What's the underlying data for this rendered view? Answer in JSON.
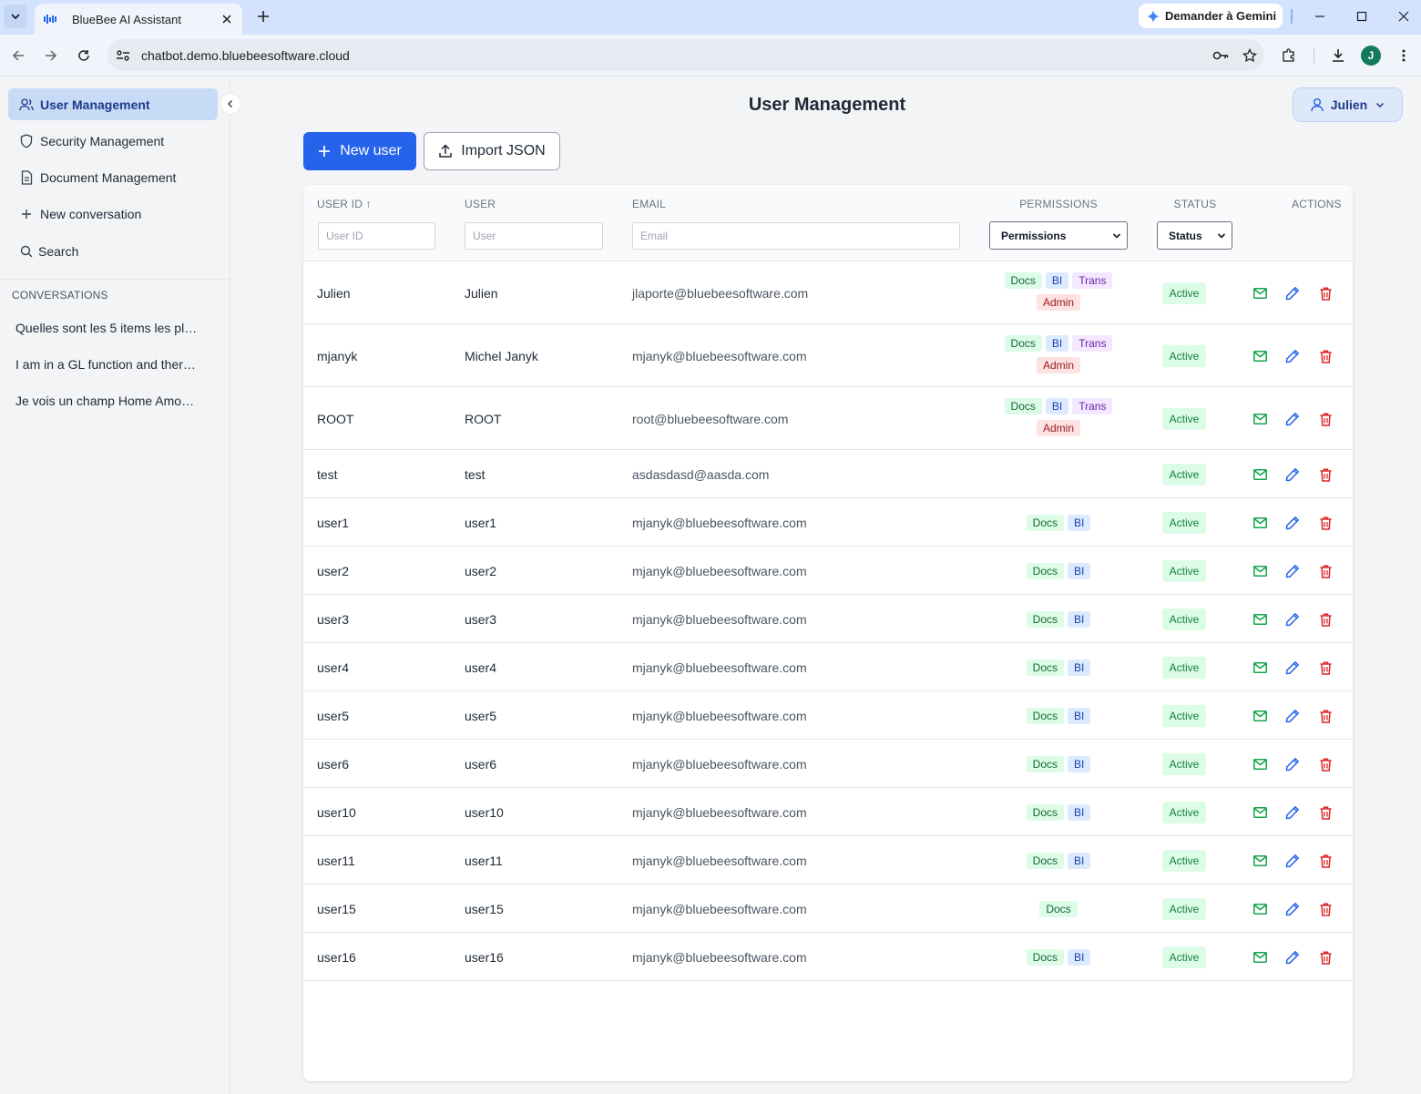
{
  "browser": {
    "tab_title": "BlueBee AI Assistant",
    "gemini_label": "Demander à Gemini",
    "url": "chatbot.demo.bluebeesoftware.cloud",
    "profile_initial": "J"
  },
  "sidebar": {
    "nav": [
      {
        "label": "User Management",
        "icon": "users-icon",
        "active": true
      },
      {
        "label": "Security Management",
        "icon": "shield-icon"
      },
      {
        "label": "Document Management",
        "icon": "document-icon"
      },
      {
        "label": "New conversation",
        "icon": "plus-icon"
      },
      {
        "label": "Search",
        "icon": "search-icon"
      }
    ],
    "conversations_heading": "CONVERSATIONS",
    "conversations": [
      "Quelles sont les 5 items les plus vendus",
      "I am in a GL function and there is",
      "Je vois un champ Home Amount"
    ]
  },
  "header": {
    "title": "User Management",
    "user_menu_label": "Julien"
  },
  "actions": {
    "new_user_label": "New user",
    "import_label": "Import JSON"
  },
  "table": {
    "columns": {
      "user_id": "USER ID ↑",
      "user": "USER",
      "email": "EMAIL",
      "permissions": "PERMISSIONS",
      "status": "STATUS",
      "actions": "ACTIONS"
    },
    "filters": {
      "user_id_placeholder": "User ID",
      "user_placeholder": "User",
      "email_placeholder": "Email",
      "permissions_selected": "Permissions",
      "status_selected": "Status"
    },
    "rows": [
      {
        "id": "Julien",
        "user": "Julien",
        "email": "jlaporte@bluebeesoftware.com",
        "perms": [
          "Docs",
          "BI",
          "Trans",
          "Admin"
        ],
        "status": "Active"
      },
      {
        "id": "mjanyk",
        "user": "Michel Janyk",
        "email": "mjanyk@bluebeesoftware.com",
        "perms": [
          "Docs",
          "BI",
          "Trans",
          "Admin"
        ],
        "status": "Active"
      },
      {
        "id": "ROOT",
        "user": "ROOT",
        "email": "root@bluebeesoftware.com",
        "perms": [
          "Docs",
          "BI",
          "Trans",
          "Admin"
        ],
        "status": "Active"
      },
      {
        "id": "test",
        "user": "test",
        "email": "asdasdasd@aasda.com",
        "perms": [],
        "status": "Active"
      },
      {
        "id": "user1",
        "user": "user1",
        "email": "mjanyk@bluebeesoftware.com",
        "perms": [
          "Docs",
          "BI"
        ],
        "status": "Active"
      },
      {
        "id": "user2",
        "user": "user2",
        "email": "mjanyk@bluebeesoftware.com",
        "perms": [
          "Docs",
          "BI"
        ],
        "status": "Active"
      },
      {
        "id": "user3",
        "user": "user3",
        "email": "mjanyk@bluebeesoftware.com",
        "perms": [
          "Docs",
          "BI"
        ],
        "status": "Active"
      },
      {
        "id": "user4",
        "user": "user4",
        "email": "mjanyk@bluebeesoftware.com",
        "perms": [
          "Docs",
          "BI"
        ],
        "status": "Active"
      },
      {
        "id": "user5",
        "user": "user5",
        "email": "mjanyk@bluebeesoftware.com",
        "perms": [
          "Docs",
          "BI"
        ],
        "status": "Active"
      },
      {
        "id": "user6",
        "user": "user6",
        "email": "mjanyk@bluebeesoftware.com",
        "perms": [
          "Docs",
          "BI"
        ],
        "status": "Active"
      },
      {
        "id": "user10",
        "user": "user10",
        "email": "mjanyk@bluebeesoftware.com",
        "perms": [
          "Docs",
          "BI"
        ],
        "status": "Active"
      },
      {
        "id": "user11",
        "user": "user11",
        "email": "mjanyk@bluebeesoftware.com",
        "perms": [
          "Docs",
          "BI"
        ],
        "status": "Active"
      },
      {
        "id": "user15",
        "user": "user15",
        "email": "mjanyk@bluebeesoftware.com",
        "perms": [
          "Docs"
        ],
        "status": "Active"
      },
      {
        "id": "user16",
        "user": "user16",
        "email": "mjanyk@bluebeesoftware.com",
        "perms": [
          "Docs",
          "BI"
        ],
        "status": "Active"
      }
    ]
  },
  "colors": {
    "primary": "#2563eb",
    "active_nav_bg": "#c7dbf7",
    "status_active_bg": "#dcfce7",
    "mail_icon": "#16a34a",
    "edit_icon": "#2563eb",
    "delete_icon": "#dc2626"
  }
}
